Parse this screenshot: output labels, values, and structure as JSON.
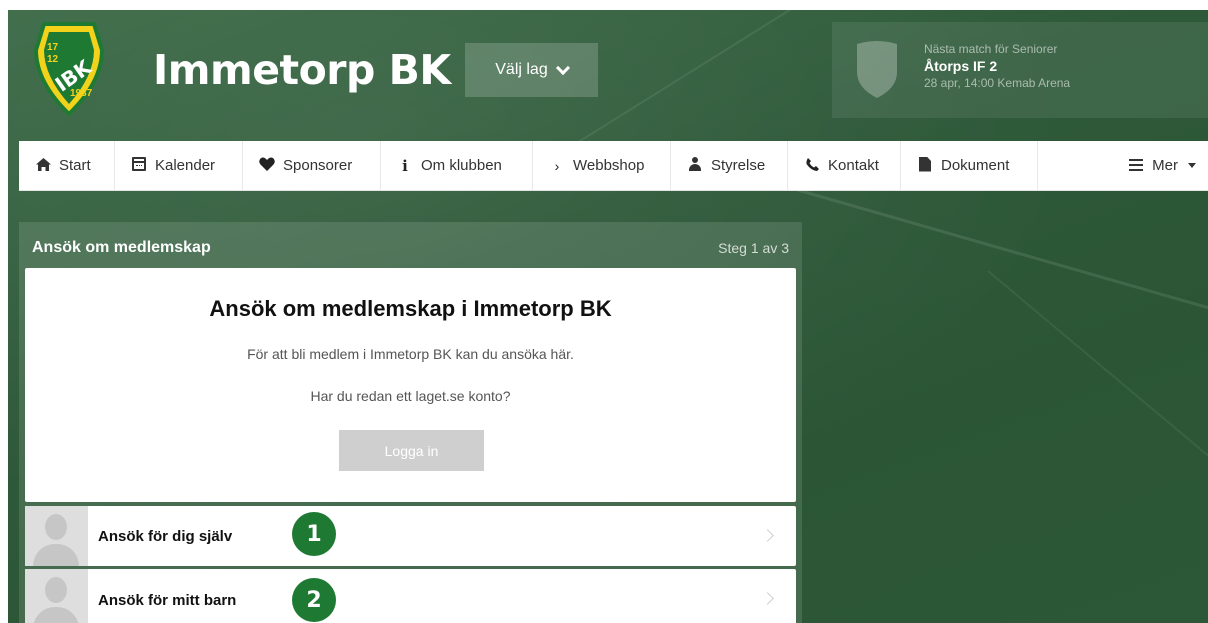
{
  "header": {
    "club_name": "Immetorp BK",
    "team_select_label": "Välj lag",
    "logo": {
      "text_top": "17",
      "text_mid": "12",
      "letters": "IBK",
      "year": "1937",
      "colors": {
        "green": "#1e7a33",
        "yellow": "#f2d21b"
      }
    }
  },
  "next_match": {
    "label": "Nästa match för Seniorer",
    "opponent": "Åtorps IF 2",
    "details": "28 apr, 14:00 Kemab Arena"
  },
  "nav": {
    "items": [
      {
        "label": "Start",
        "icon": "home-icon"
      },
      {
        "label": "Kalender",
        "icon": "calendar-icon"
      },
      {
        "label": "Sponsorer",
        "icon": "heart-icon"
      },
      {
        "label": "Om klubben",
        "icon": "info-icon"
      },
      {
        "label": "Webbshop",
        "icon": "chevron-right-icon"
      },
      {
        "label": "Styrelse",
        "icon": "user-icon"
      },
      {
        "label": "Kontakt",
        "icon": "phone-icon"
      },
      {
        "label": "Dokument",
        "icon": "document-icon"
      }
    ],
    "more_label": "Mer"
  },
  "panel": {
    "title": "Ansök om medlemskap",
    "step": "Steg 1 av 3",
    "card": {
      "heading": "Ansök om medlemskap i Immetorp BK",
      "description": "För att bli medlem i Immetorp BK kan du ansöka här.",
      "question": "Har du redan ett laget.se konto?",
      "login_button": "Logga in"
    },
    "options": [
      {
        "label": "Ansök för dig själv",
        "badge": "1"
      },
      {
        "label": "Ansök för mitt barn",
        "badge": "2"
      }
    ]
  },
  "colors": {
    "background_green": "#2f5a3a",
    "badge_green": "#1e7a33",
    "login_disabled": "#cfcfcf"
  }
}
